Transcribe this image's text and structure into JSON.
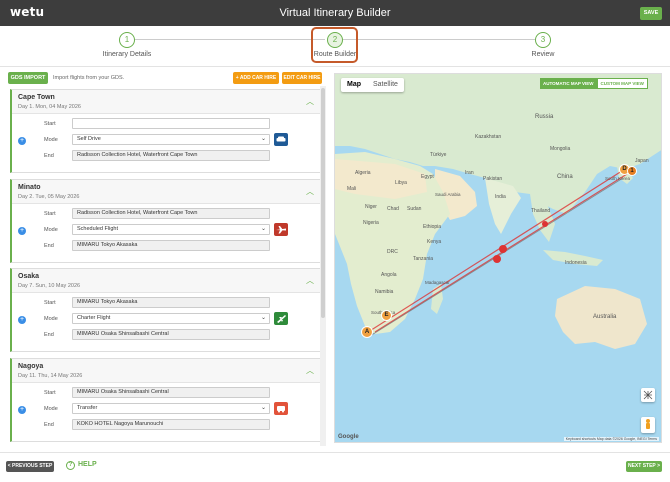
{
  "header": {
    "logo": "wetu",
    "title": "Virtual Itinerary Builder",
    "save_label": "SAVE"
  },
  "steps": [
    {
      "num": "1",
      "label": "Itinerary Details"
    },
    {
      "num": "2",
      "label": "Route Builder"
    },
    {
      "num": "3",
      "label": "Review"
    }
  ],
  "toolbar": {
    "gds_label": "GDS IMPORT",
    "gds_text": "Import flights from your GDS.",
    "add_car_label": "+ ADD CAR HIRE",
    "edit_car_label": "EDIT CAR HIRE"
  },
  "labels": {
    "start": "Start",
    "mode": "Mode",
    "end": "End"
  },
  "days": [
    {
      "city": "Cape Town",
      "date": "Day 1. Mon, 04 May 2026",
      "start": "",
      "mode": "Self Drive",
      "end": "Radisson Collection Hotel, Waterfront Cape Town",
      "mode_color": "#1f5a96"
    },
    {
      "city": "Minato",
      "date": "Day 2. Tue, 05 May 2026",
      "start": "Radisson Collection Hotel, Waterfront Cape Town",
      "mode": "Scheduled Flight",
      "end": "MIMARU Tokyo Akasaka",
      "mode_color": "#c0392b"
    },
    {
      "city": "Osaka",
      "date": "Day 7. Sun, 10 May 2026",
      "start": "MIMARU Tokyo Akasaka",
      "mode": "Charter Flight",
      "end": "MIMARU Osaka Shinsaibashi Central",
      "mode_color": "#2e8b3a"
    },
    {
      "city": "Nagoya",
      "date": "Day 11. Thu, 14 May 2026",
      "start": "MIMARU Osaka Shinsaibashi Central",
      "mode": "Transfer",
      "end": "KOKO HOTEL Nagoya Marunouchi",
      "mode_color": "#e2533a"
    }
  ],
  "map": {
    "tab_map": "Map",
    "tab_satellite": "Satellite",
    "auto_view": "AUTOMATIC MAP VIEW",
    "custom_view": "CUSTOM MAP VIEW",
    "footer": "Keyboard shortcuts   Map data ©2026 Google, INEGI   Terms",
    "google": "Google",
    "regions": {
      "libya": "Libya",
      "egypt": "Egypt",
      "sudan": "Sudan",
      "ethiopia": "Ethiopia",
      "drc": "DRC",
      "tanzania": "Tanzania",
      "namibia": "Namibia",
      "madagascar": "Madagascar",
      "south_africa": "South Africa",
      "iran": "Iran",
      "saudi": "Saudi Arabia",
      "pakistan": "Pakistan",
      "india": "India",
      "china": "China",
      "mongolia": "Mongolia",
      "kazakhstan": "Kazakhstan",
      "russia": "Russia",
      "thailand": "Thailand",
      "indonesia": "Indonesia",
      "australia": "Australia",
      "mali": "Mali",
      "niger": "Niger",
      "nigeria": "Nigeria",
      "chad": "Chad",
      "algeria": "Algeria",
      "angola": "Angola",
      "kenya": "Kenya",
      "turkey": "Türkiye",
      "japan": "Japan",
      "south_korea": "South Korea"
    },
    "markers": {
      "a": "A",
      "e": "E",
      "d": "D",
      "one": "1"
    }
  },
  "footer": {
    "prev_label": "< PREVIOUS STEP",
    "help_label": "HELP",
    "next_label": "NEXT STEP >"
  }
}
